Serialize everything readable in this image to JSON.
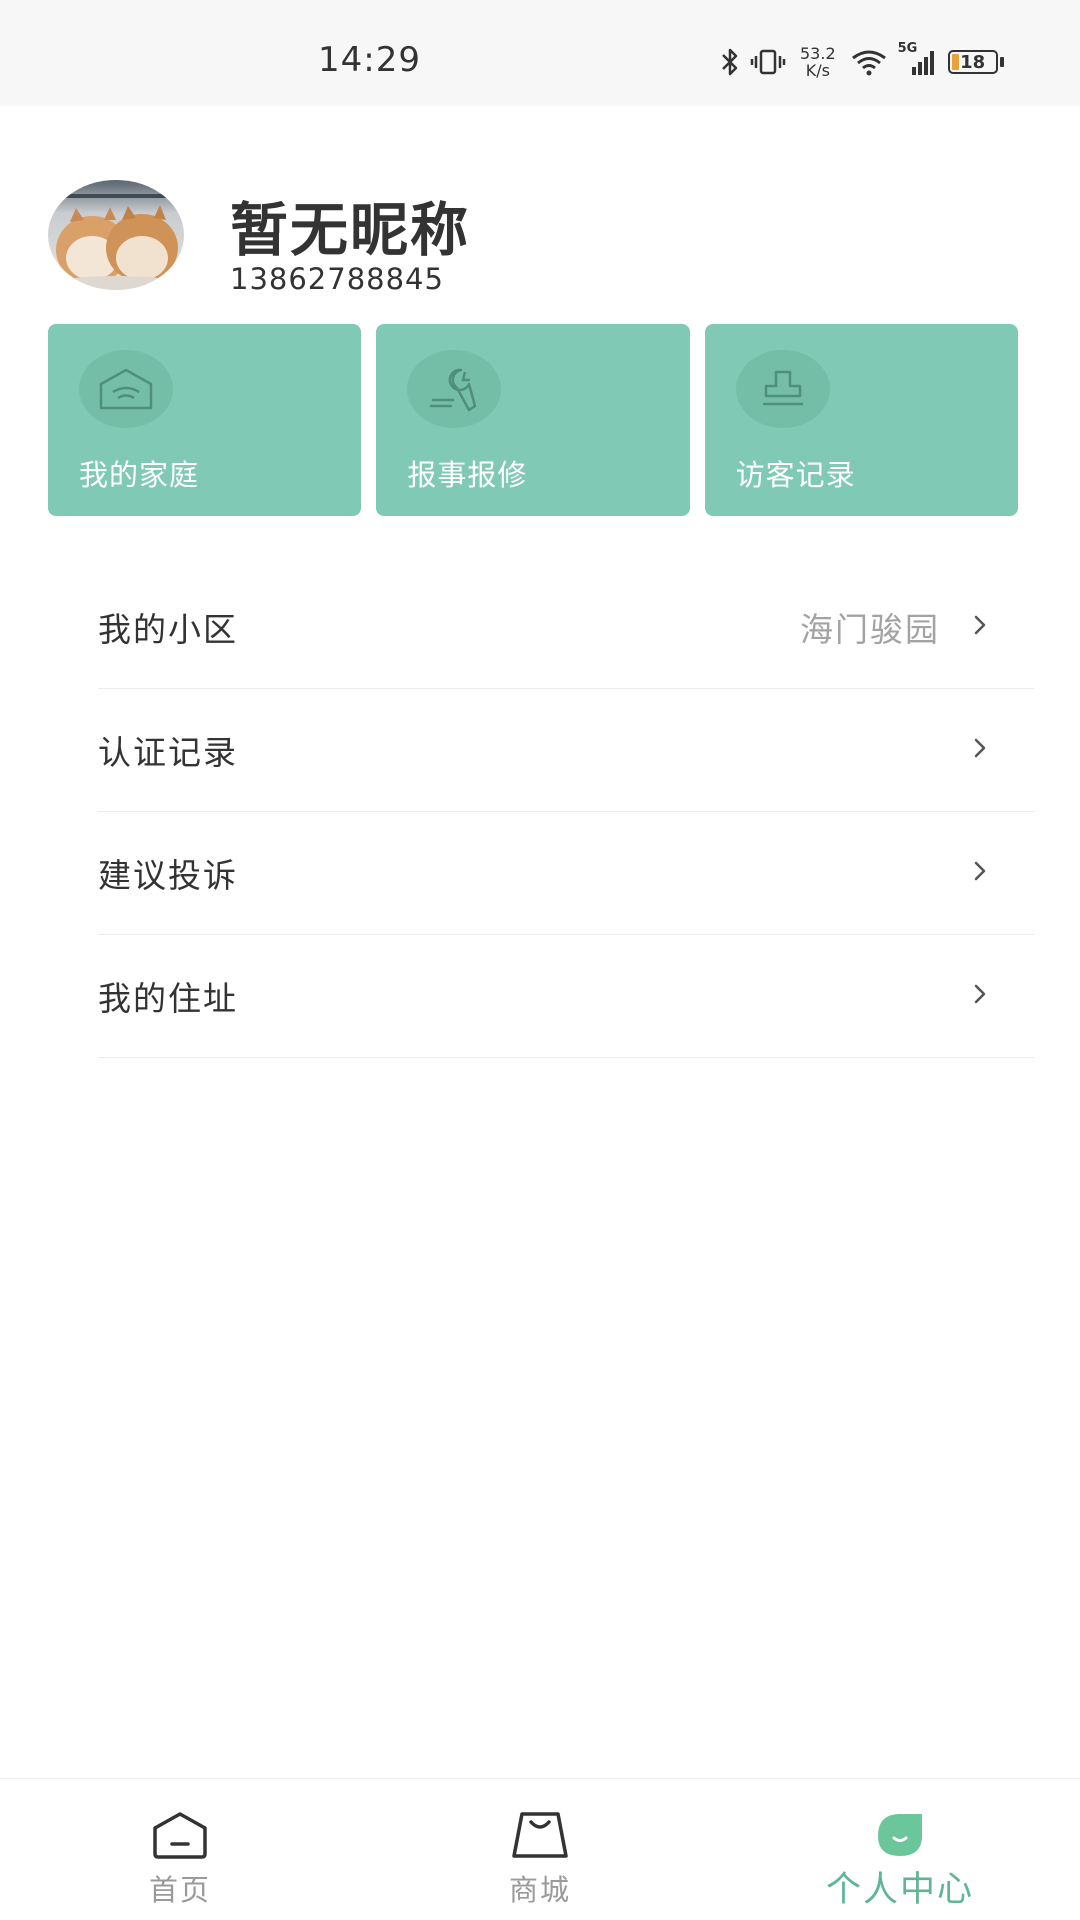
{
  "status_bar": {
    "time": "14:29",
    "net_speed_value": "53.2",
    "net_speed_unit": "K/s",
    "network_type": "5G",
    "battery_level": "18",
    "icons": [
      "bluetooth-icon",
      "vibrate-icon",
      "wifi-icon",
      "signal-icon",
      "battery-icon"
    ]
  },
  "profile": {
    "nickname": "暂无昵称",
    "phone": "13862788845"
  },
  "quick_actions": [
    {
      "label": "我的家庭",
      "icon": "home-icon"
    },
    {
      "label": "报事报修",
      "icon": "wrench-icon"
    },
    {
      "label": "访客记录",
      "icon": "visitor-icon"
    }
  ],
  "menu": [
    {
      "label": "我的小区",
      "value": "海门骏园"
    },
    {
      "label": "认证记录",
      "value": ""
    },
    {
      "label": "建议投诉",
      "value": ""
    },
    {
      "label": "我的住址",
      "value": ""
    }
  ],
  "tabs": [
    {
      "label": "首页",
      "icon": "home-tab-icon",
      "active": false
    },
    {
      "label": "商城",
      "icon": "shop-bag-icon",
      "active": false
    },
    {
      "label": "个人中心",
      "icon": "profile-leaf-icon",
      "active": true
    }
  ],
  "colors": {
    "accent": "#80c9b5",
    "accent_active_text": "#5fb594",
    "text_primary": "#333333",
    "text_secondary": "#a3a3a3",
    "tab_inactive": "#9a9a9a"
  }
}
